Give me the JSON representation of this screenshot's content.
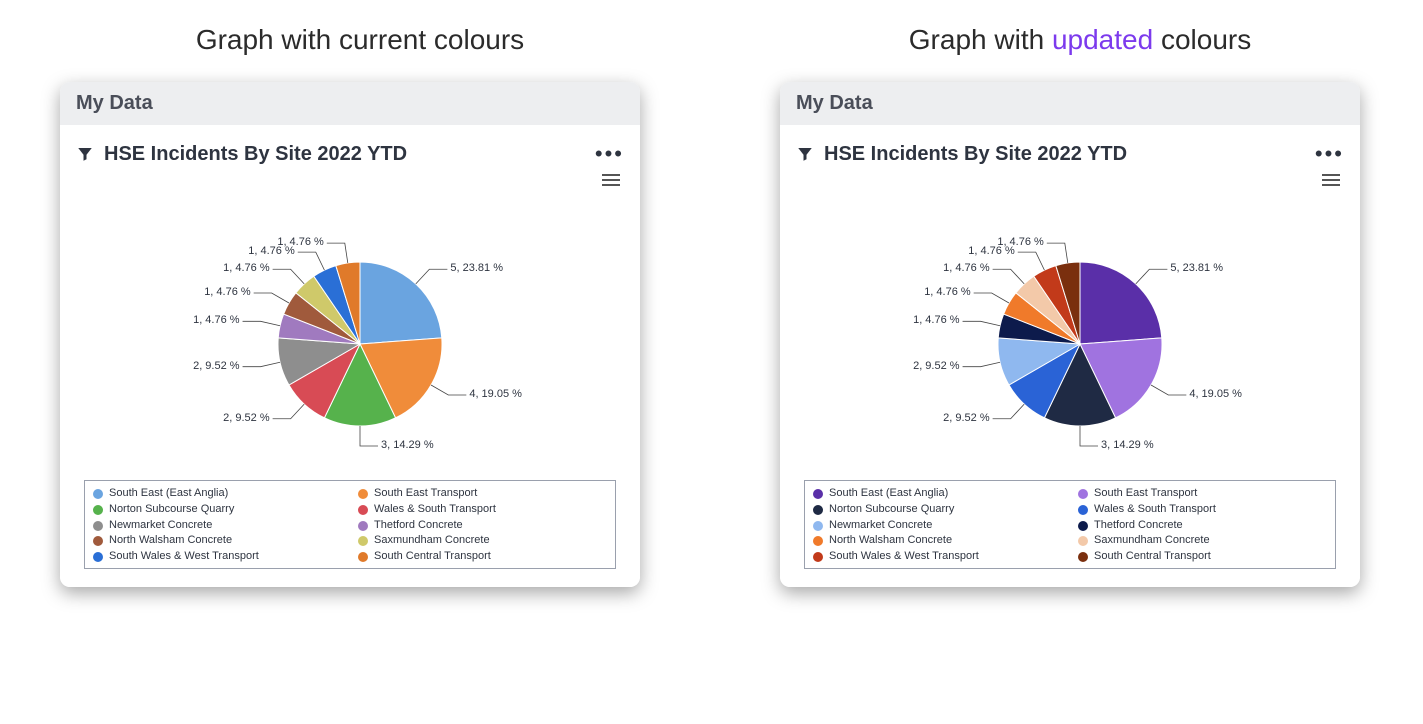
{
  "captions": {
    "left_pre": "Graph with current colours",
    "right_pre": "Graph with ",
    "right_accent": "updated",
    "right_post": " colours"
  },
  "panel": {
    "header": "My Data",
    "chart_title": "HSE Incidents By Site 2022 YTD"
  },
  "chart_data": [
    {
      "type": "pie",
      "title": "HSE Incidents By Site 2022 YTD",
      "palette_name": "current",
      "series": [
        {
          "name": "South East (East Anglia)",
          "value": 5,
          "pct": 23.81,
          "color": "#6aa4e0",
          "label": "5, 23.81 %"
        },
        {
          "name": "South East Transport",
          "value": 4,
          "pct": 19.05,
          "color": "#f08c3a",
          "label": "4, 19.05 %"
        },
        {
          "name": "Norton Subcourse Quarry",
          "value": 3,
          "pct": 14.29,
          "color": "#56b24c",
          "label": "3, 14.29 %"
        },
        {
          "name": "Wales & South Transport",
          "value": 2,
          "pct": 9.52,
          "color": "#d84b55",
          "label": "2, 9.52 %"
        },
        {
          "name": "Newmarket Concrete",
          "value": 2,
          "pct": 9.52,
          "color": "#8e8e8e",
          "label": "2, 9.52 %"
        },
        {
          "name": "Thetford Concrete",
          "value": 1,
          "pct": 4.76,
          "color": "#a07abf",
          "label": "1, 4.76 %"
        },
        {
          "name": "North Walsham Concrete",
          "value": 1,
          "pct": 4.76,
          "color": "#a05a3c",
          "label": "1, 4.76 %"
        },
        {
          "name": "Saxmundham Concrete",
          "value": 1,
          "pct": 4.76,
          "color": "#cfc96a",
          "label": "1, 4.76 %"
        },
        {
          "name": "South Wales & West Transport",
          "value": 1,
          "pct": 4.76,
          "color": "#2a6fd6",
          "label": "1, 4.76 %"
        },
        {
          "name": "South Central Transport",
          "value": 1,
          "pct": 4.76,
          "color": "#e07a2a",
          "label": "1, 4.76 %"
        }
      ]
    },
    {
      "type": "pie",
      "title": "HSE Incidents By Site 2022 YTD",
      "palette_name": "updated",
      "series": [
        {
          "name": "South East (East Anglia)",
          "value": 5,
          "pct": 23.81,
          "color": "#5a2fa8",
          "label": "5, 23.81 %"
        },
        {
          "name": "South East Transport",
          "value": 4,
          "pct": 19.05,
          "color": "#a073e0",
          "label": "4, 19.05 %"
        },
        {
          "name": "Norton Subcourse Quarry",
          "value": 3,
          "pct": 14.29,
          "color": "#1f2a44",
          "label": "3, 14.29 %"
        },
        {
          "name": "Wales & South Transport",
          "value": 2,
          "pct": 9.52,
          "color": "#2a63d6",
          "label": "2, 9.52 %"
        },
        {
          "name": "Newmarket Concrete",
          "value": 2,
          "pct": 9.52,
          "color": "#8fb8ef",
          "label": "2, 9.52 %"
        },
        {
          "name": "Thetford Concrete",
          "value": 1,
          "pct": 4.76,
          "color": "#0d1b4c",
          "label": "1, 4.76 %"
        },
        {
          "name": "North Walsham Concrete",
          "value": 1,
          "pct": 4.76,
          "color": "#f07a2a",
          "label": "1, 4.76 %"
        },
        {
          "name": "Saxmundham Concrete",
          "value": 1,
          "pct": 4.76,
          "color": "#f3c9a9",
          "label": "1, 4.76 %"
        },
        {
          "name": "South Wales & West Transport",
          "value": 1,
          "pct": 4.76,
          "color": "#c23a1a",
          "label": "1, 4.76 %"
        },
        {
          "name": "South Central Transport",
          "value": 1,
          "pct": 4.76,
          "color": "#7a2f0e",
          "label": "1, 4.76 %"
        }
      ]
    }
  ],
  "legend_order": [
    0,
    1,
    2,
    3,
    4,
    5,
    6,
    7,
    8,
    9
  ]
}
